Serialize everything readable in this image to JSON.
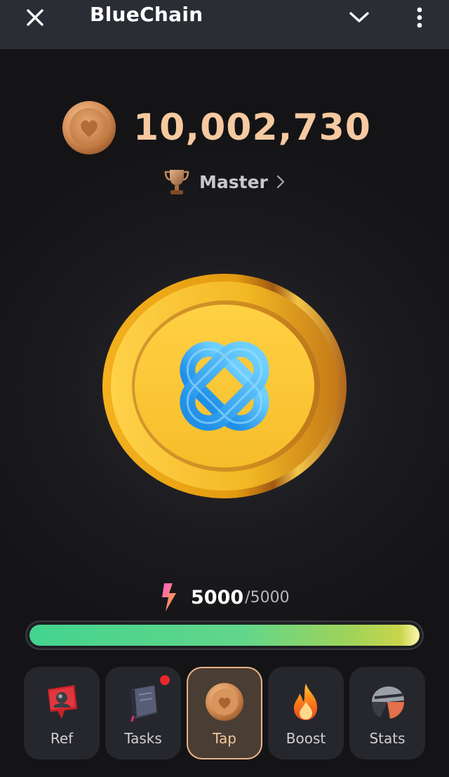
{
  "header": {
    "title": "BlueChain",
    "close_icon": "close-icon",
    "menu_icons": [
      "chevron-down-icon",
      "more-vertical-icon"
    ]
  },
  "balance": {
    "value": "10,002,730",
    "icon": "coin-icon",
    "color": "#f6c9a0"
  },
  "league": {
    "label": "Master",
    "icon": "trophy-icon",
    "chevron": "chevron-right-icon"
  },
  "tap_coin": {
    "icon": "bluechain-logo-coin"
  },
  "energy": {
    "current": "5000",
    "separator": "/",
    "max": "5000",
    "fraction": 1.0,
    "icon": "lightning-icon"
  },
  "nav": {
    "items": [
      {
        "label": "Ref",
        "icon": "referral-icon",
        "active": false,
        "badge": false
      },
      {
        "label": "Tasks",
        "icon": "notebook-icon",
        "active": false,
        "badge": true
      },
      {
        "label": "Tap",
        "icon": "coin-icon",
        "active": true,
        "badge": false
      },
      {
        "label": "Boost",
        "icon": "fire-icon",
        "active": false,
        "badge": false
      },
      {
        "label": "Stats",
        "icon": "stats-icon",
        "active": false,
        "badge": false
      }
    ]
  },
  "colors": {
    "background": "#141416",
    "header": "#2a2d34",
    "accent": "#e7b48a",
    "energy_start": "#43d38e",
    "energy_end": "#c8d54a",
    "badge": "#e5282e"
  }
}
